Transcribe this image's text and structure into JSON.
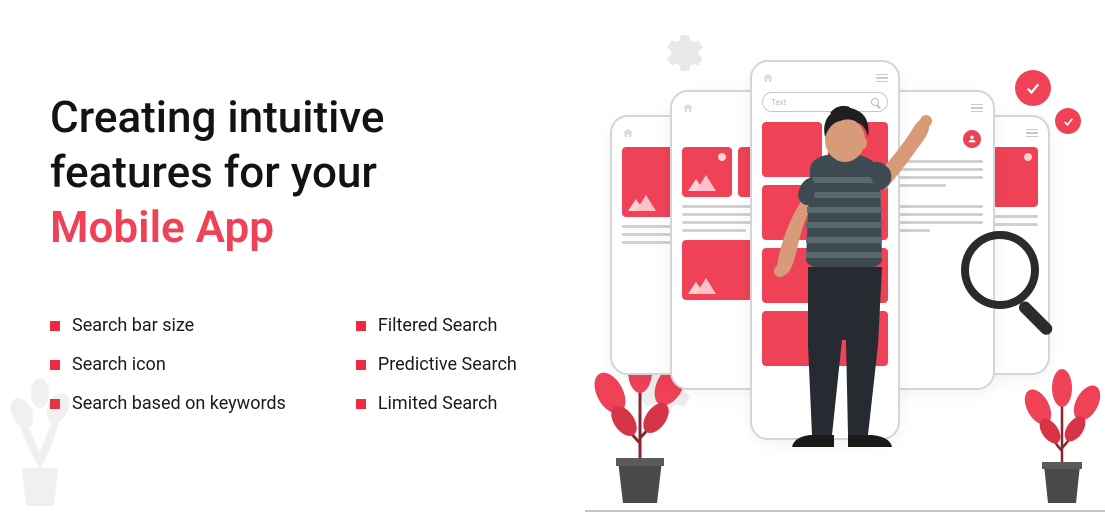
{
  "title": {
    "line1": "Creating intuitive",
    "line2": "features for your",
    "accent": "Mobile App"
  },
  "features": {
    "col1": [
      "Search bar size",
      "Search icon",
      "Search based on keywords"
    ],
    "col2": [
      "Filtered Search",
      "Predictive Search",
      "Limited Search"
    ]
  },
  "illustration": {
    "search_placeholder": "Text"
  },
  "colors": {
    "accent": "#ef4256",
    "text": "#131313"
  }
}
